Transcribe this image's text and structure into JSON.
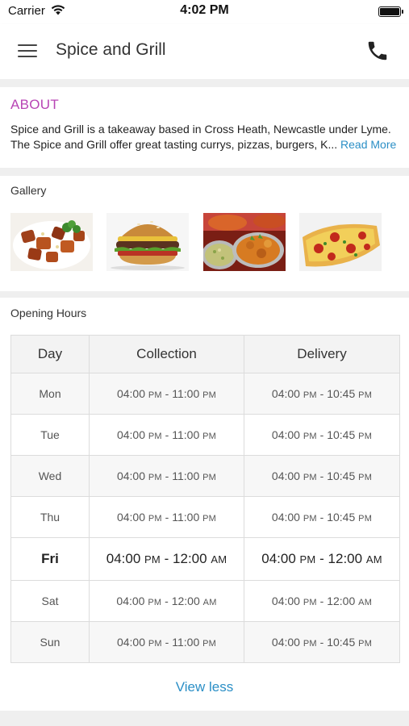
{
  "status_bar": {
    "carrier": "Carrier",
    "time": "4:02 PM",
    "icons": [
      "wifi-icon",
      "battery-icon"
    ]
  },
  "header": {
    "title": "Spice and Grill",
    "menu_icon": "hamburger-menu-icon",
    "phone_icon": "phone-icon"
  },
  "about": {
    "heading": "ABOUT",
    "line1": "Spice and Grill is a takeaway based in Cross Heath, Newcastle under Lyme.",
    "line2": "The Spice and Grill offer great tasting currys, pizzas, burgers, K...",
    "read_more": "Read More"
  },
  "gallery": {
    "heading": "Gallery",
    "images": [
      "chicken-tikka-dish",
      "burger",
      "curry-dishes",
      "pizza"
    ]
  },
  "opening_hours": {
    "heading": "Opening Hours",
    "columns": [
      "Day",
      "Collection",
      "Delivery"
    ],
    "rows": [
      {
        "day": "Mon",
        "col_start": "04:00",
        "col_start_ampm": "PM",
        "col_end": "11:00",
        "col_end_ampm": "PM",
        "del_start": "04:00",
        "del_start_ampm": "PM",
        "del_end": "10:45",
        "del_end_ampm": "PM"
      },
      {
        "day": "Tue",
        "col_start": "04:00",
        "col_start_ampm": "PM",
        "col_end": "11:00",
        "col_end_ampm": "PM",
        "del_start": "04:00",
        "del_start_ampm": "PM",
        "del_end": "10:45",
        "del_end_ampm": "PM"
      },
      {
        "day": "Wed",
        "col_start": "04:00",
        "col_start_ampm": "PM",
        "col_end": "11:00",
        "col_end_ampm": "PM",
        "del_start": "04:00",
        "del_start_ampm": "PM",
        "del_end": "10:45",
        "del_end_ampm": "PM"
      },
      {
        "day": "Thu",
        "col_start": "04:00",
        "col_start_ampm": "PM",
        "col_end": "11:00",
        "col_end_ampm": "PM",
        "del_start": "04:00",
        "del_start_ampm": "PM",
        "del_end": "10:45",
        "del_end_ampm": "PM"
      },
      {
        "day": "Fri",
        "col_start": "04:00",
        "col_start_ampm": "PM",
        "col_end": "12:00",
        "col_end_ampm": "AM",
        "del_start": "04:00",
        "del_start_ampm": "PM",
        "del_end": "12:00",
        "del_end_ampm": "AM",
        "highlighted": true
      },
      {
        "day": "Sat",
        "col_start": "04:00",
        "col_start_ampm": "PM",
        "col_end": "12:00",
        "col_end_ampm": "AM",
        "del_start": "04:00",
        "del_start_ampm": "PM",
        "del_end": "12:00",
        "del_end_ampm": "AM"
      },
      {
        "day": "Sun",
        "col_start": "04:00",
        "col_start_ampm": "PM",
        "col_end": "11:00",
        "col_end_ampm": "PM",
        "del_start": "04:00",
        "del_start_ampm": "PM",
        "del_end": "10:45",
        "del_end_ampm": "PM"
      }
    ],
    "toggle_label": "View less"
  },
  "colors": {
    "accent_link": "#2b8fc6",
    "about_heading": "#b845b5",
    "section_gap": "#efefef"
  }
}
